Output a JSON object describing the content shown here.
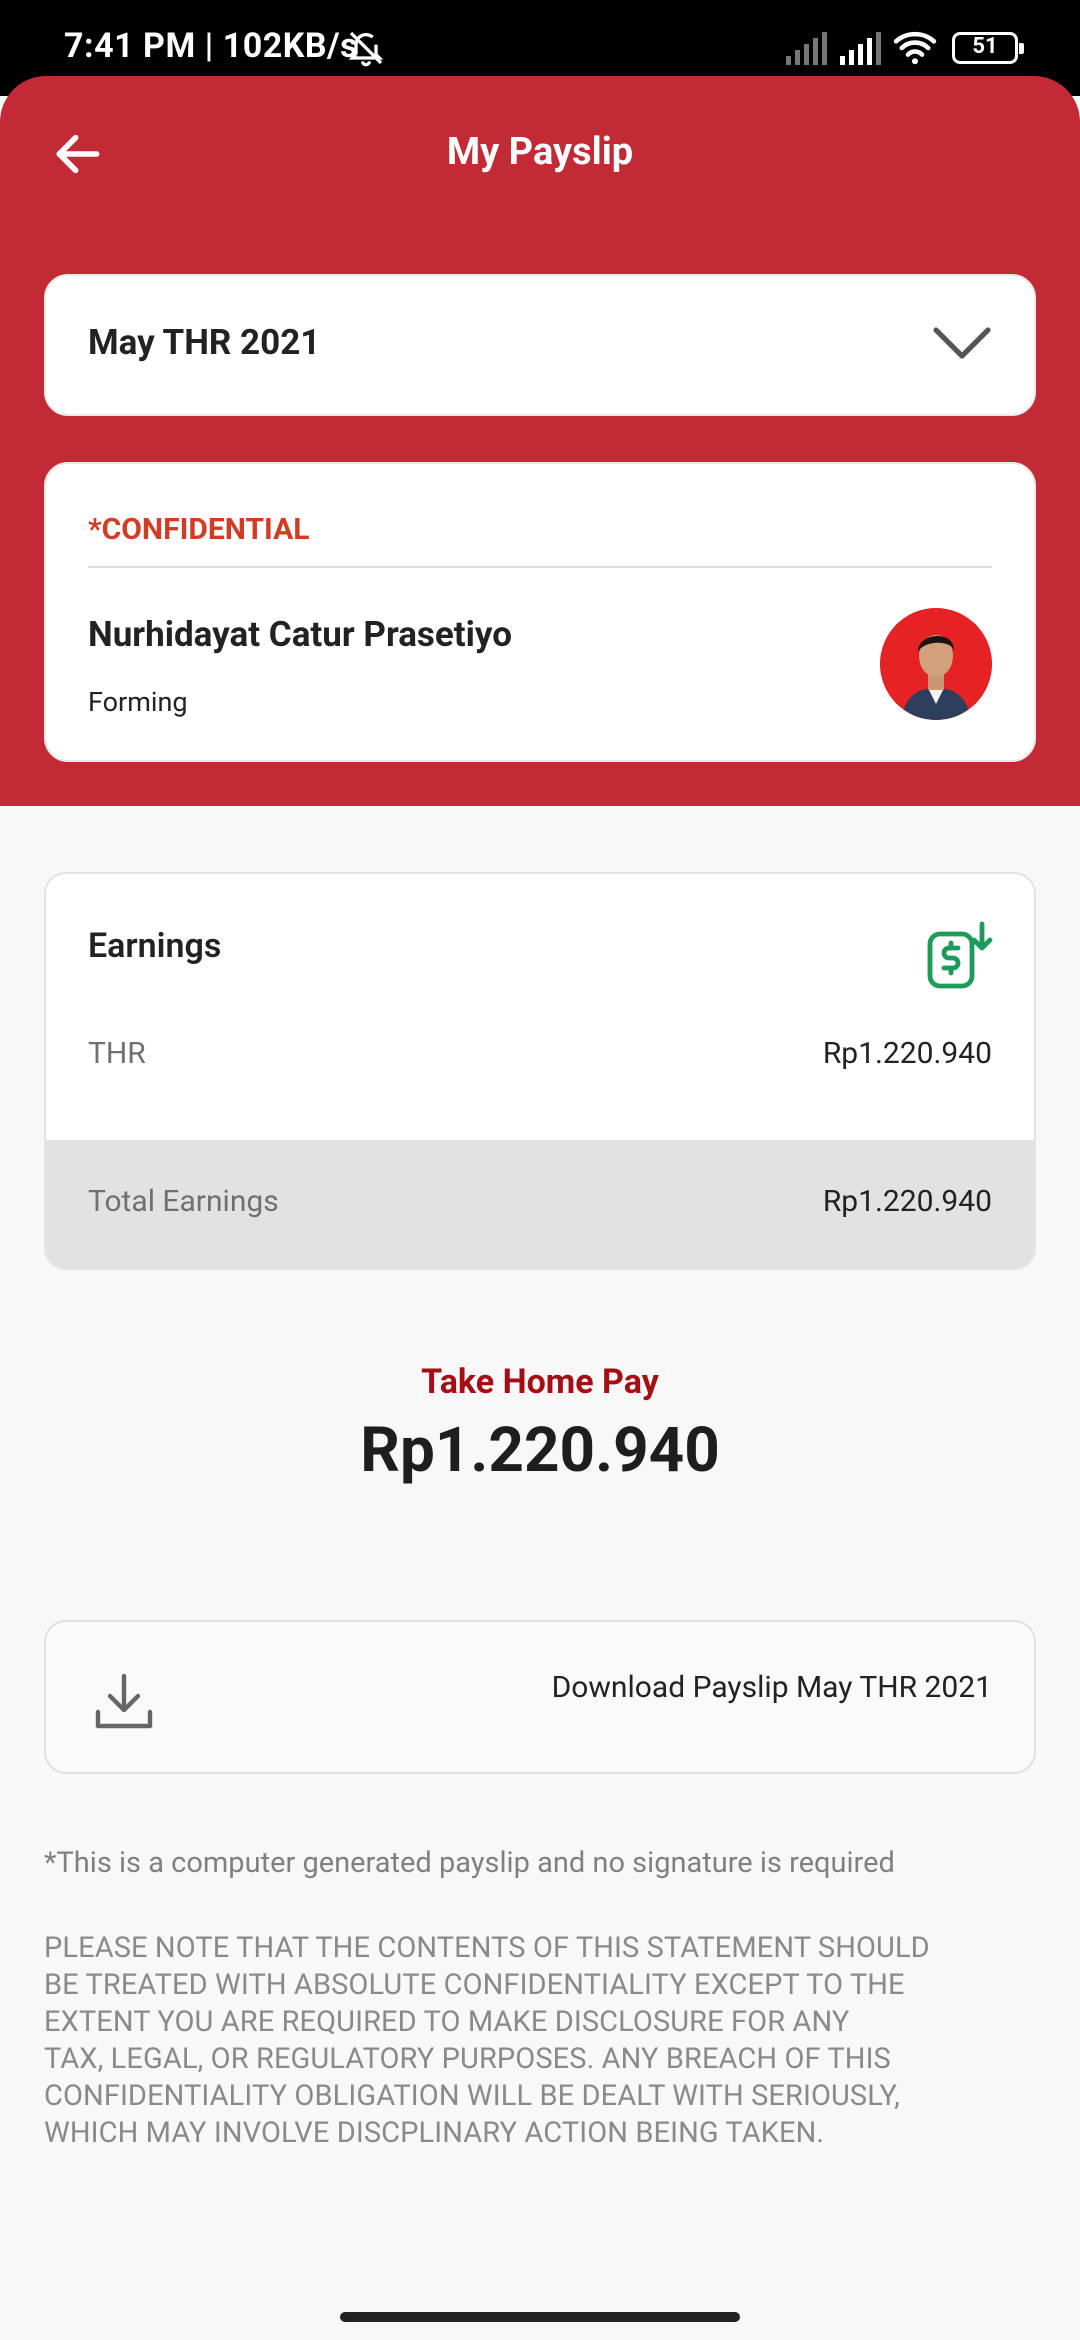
{
  "status_bar": {
    "time": "7:41 PM | 102KB/s",
    "battery": "51",
    "icons": [
      "bell-off-icon",
      "signal-icon",
      "signal-icon",
      "wifi-icon",
      "battery-icon"
    ]
  },
  "header": {
    "title": "My Payslip",
    "back_icon": "arrow-left-icon",
    "background_color": "#c22a36"
  },
  "period_select": {
    "selected": "May THR 2021",
    "icon": "chevron-down-icon"
  },
  "employee": {
    "confidential_label": "*CONFIDENTIAL",
    "name": "Nurhidayat Catur Prasetiyo",
    "department": "Forming"
  },
  "earnings": {
    "title": "Earnings",
    "icon": "money-download-icon",
    "rows": [
      {
        "label": "THR",
        "value": "Rp1.220.940"
      }
    ],
    "total_label": "Total Earnings",
    "total_value": "Rp1.220.940"
  },
  "take_home": {
    "label": "Take Home Pay",
    "value": "Rp1.220.940"
  },
  "download": {
    "label": "Download Payslip May THR 2021",
    "icon": "download-icon"
  },
  "note": "*This is a computer generated payslip and no signature is required",
  "disclaimer": [
    "PLEASE NOTE THAT THE CONTENTS OF THIS STATEMENT SHOULD",
    "BE TREATED WITH ABSOLUTE CONFIDENTIALITY EXCEPT TO THE",
    "EXTENT YOU ARE REQUIRED TO MAKE DISCLOSURE FOR ANY",
    "TAX, LEGAL, OR REGULATORY PURPOSES. ANY BREACH OF THIS",
    "CONFIDENTIALITY OBLIGATION WILL BE DEALT WITH SERIOUSLY,",
    "WHICH MAY INVOLVE DISCPLINARY ACTION BEING TAKEN."
  ]
}
